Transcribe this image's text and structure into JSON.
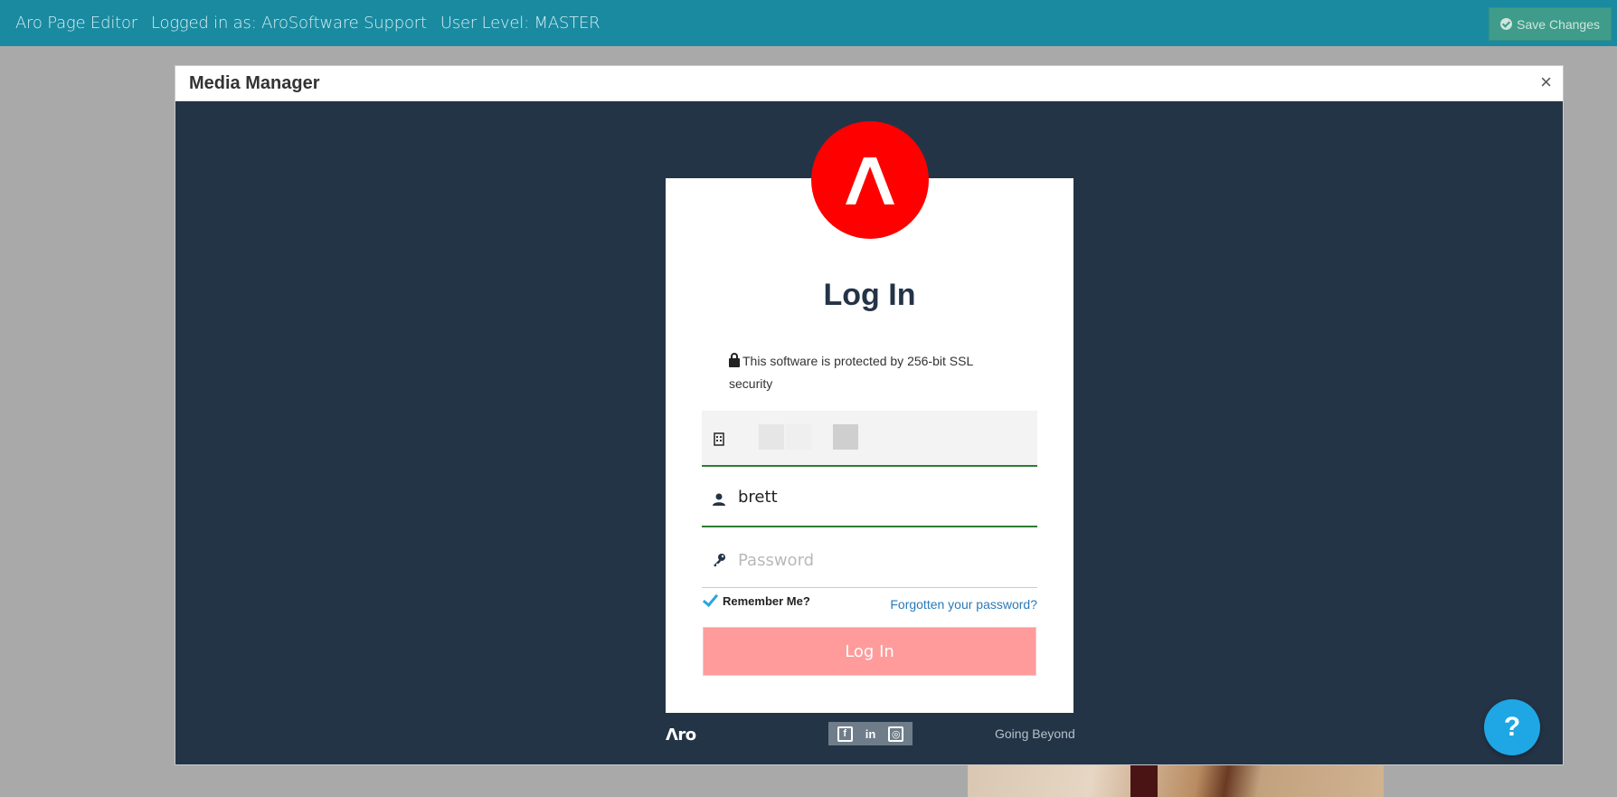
{
  "topbar": {
    "app_name": "Aro Page Editor",
    "logged_in": "Logged in as: AroSoftware Support",
    "user_level": "User Level: MASTER",
    "save_label": "Save Changes"
  },
  "modal": {
    "title": "Media Manager",
    "close_label": "×"
  },
  "login": {
    "logo_letter": "Λ",
    "title": "Log In",
    "ssl_notice": "This software is protected by 256-bit SSL security",
    "username_value": "brett",
    "password_placeholder": "Password",
    "remember_label": "Remember Me?",
    "forgot_label": "Forgotten your password?",
    "button_label": "Log In"
  },
  "footer": {
    "brand": "Λro",
    "social_icons": [
      "facebook-icon",
      "linkedin-icon",
      "instagram-icon"
    ],
    "social_labels": [
      "f",
      "in",
      "◎"
    ],
    "tagline": "Going Beyond"
  },
  "help": {
    "label": "?"
  },
  "colors": {
    "topbar": "#1a8aa0",
    "modal_body": "#243447",
    "logo": "#ff0000",
    "login_button": "#ff9b9b",
    "help_button": "#1ea7e4",
    "link": "#2a7ab8"
  }
}
